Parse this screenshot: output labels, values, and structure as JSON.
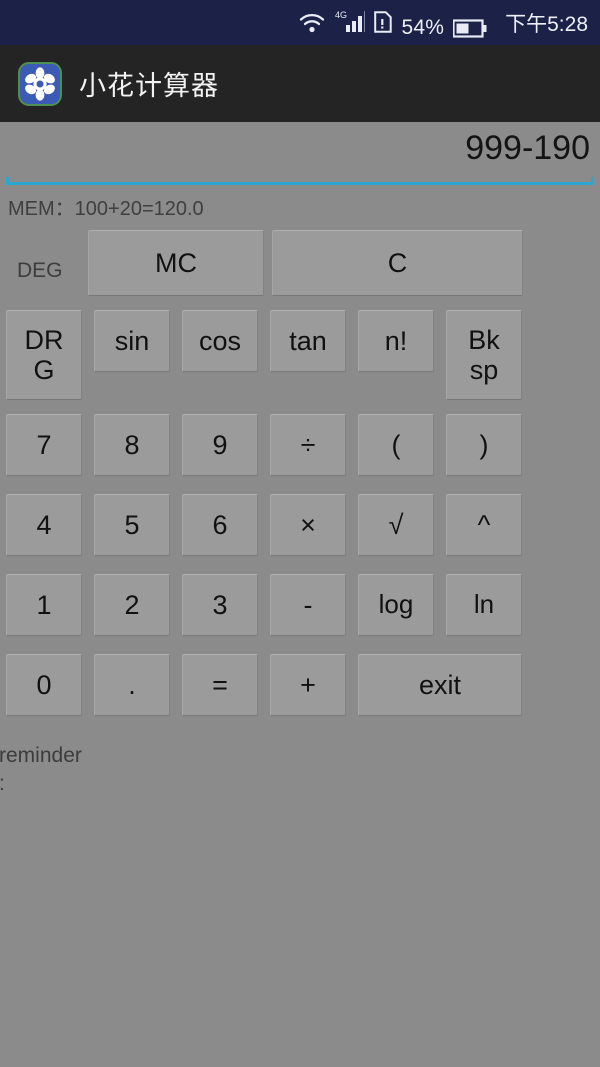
{
  "status_bar": {
    "network_type": "4G",
    "battery_percent": "54%",
    "time": "下午5:28",
    "icons": [
      "wifi-icon",
      "signal-bars-icon",
      "sim-card-icon",
      "battery-icon"
    ]
  },
  "app_bar": {
    "title": "小花计算器",
    "icon": "flower-app-icon",
    "icon_colors": {
      "circle": "#3b5bb5",
      "ring": "#4f8f52",
      "petals": "#ffffff"
    }
  },
  "display": {
    "expression": "999-190",
    "memory_line": "MEM：100+20=120.0",
    "underline_color": "#2aa6cf"
  },
  "mode": {
    "angle_unit": "DEG"
  },
  "keys": {
    "mem_clear": "MC",
    "clear": "C",
    "drg": "DR\nG",
    "sin": "sin",
    "cos": "cos",
    "tan": "tan",
    "factorial": "n!",
    "backspace": "Bk\nsp",
    "seven": "7",
    "eight": "8",
    "nine": "9",
    "divide": "÷",
    "paren_open": "(",
    "paren_close": ")",
    "four": "4",
    "five": "5",
    "six": "6",
    "multiply": "×",
    "sqrt": "√",
    "power": "^",
    "one": "1",
    "two": "2",
    "three": "3",
    "minus": "-",
    "log": "log",
    "ln": "ln",
    "zero": "0",
    "dot": ".",
    "equals": "=",
    "plus": "+",
    "exit": "exit"
  },
  "footer": {
    "reminder": "reminder\n:"
  },
  "colors": {
    "status_bar_bg": "#1b2147",
    "app_bar_bg": "#242424",
    "page_bg": "#8b8b8b",
    "button_bg": "#9b9b9b",
    "accent": "#2aa6cf"
  }
}
